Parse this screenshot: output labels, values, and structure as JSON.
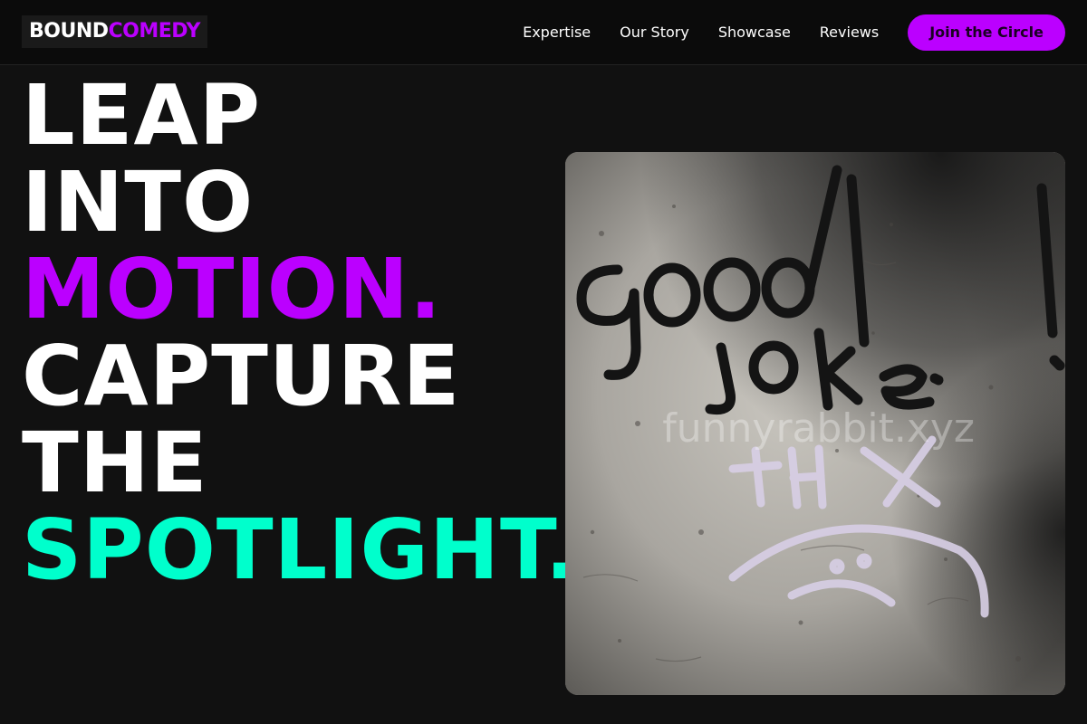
{
  "header": {
    "logo": {
      "part1": "BOUND",
      "part2": "COMEDY"
    },
    "nav": [
      {
        "label": "Expertise"
      },
      {
        "label": "Our Story"
      },
      {
        "label": "Showcase"
      },
      {
        "label": "Reviews"
      }
    ],
    "cta_label": "Join the Circle"
  },
  "hero": {
    "lines": [
      "LEAP",
      "INTO",
      "MOTION.",
      "CAPTURE",
      "THE",
      "SPOTLIGHT."
    ],
    "image": {
      "watermark": "funnyrabbit.xyz",
      "graffiti_text": "good joke",
      "graffiti_tag": "THX"
    }
  },
  "colors": {
    "background": "#111111",
    "accent_purple": "#bb00ff",
    "accent_teal": "#00ffcc",
    "text": "#ffffff"
  }
}
